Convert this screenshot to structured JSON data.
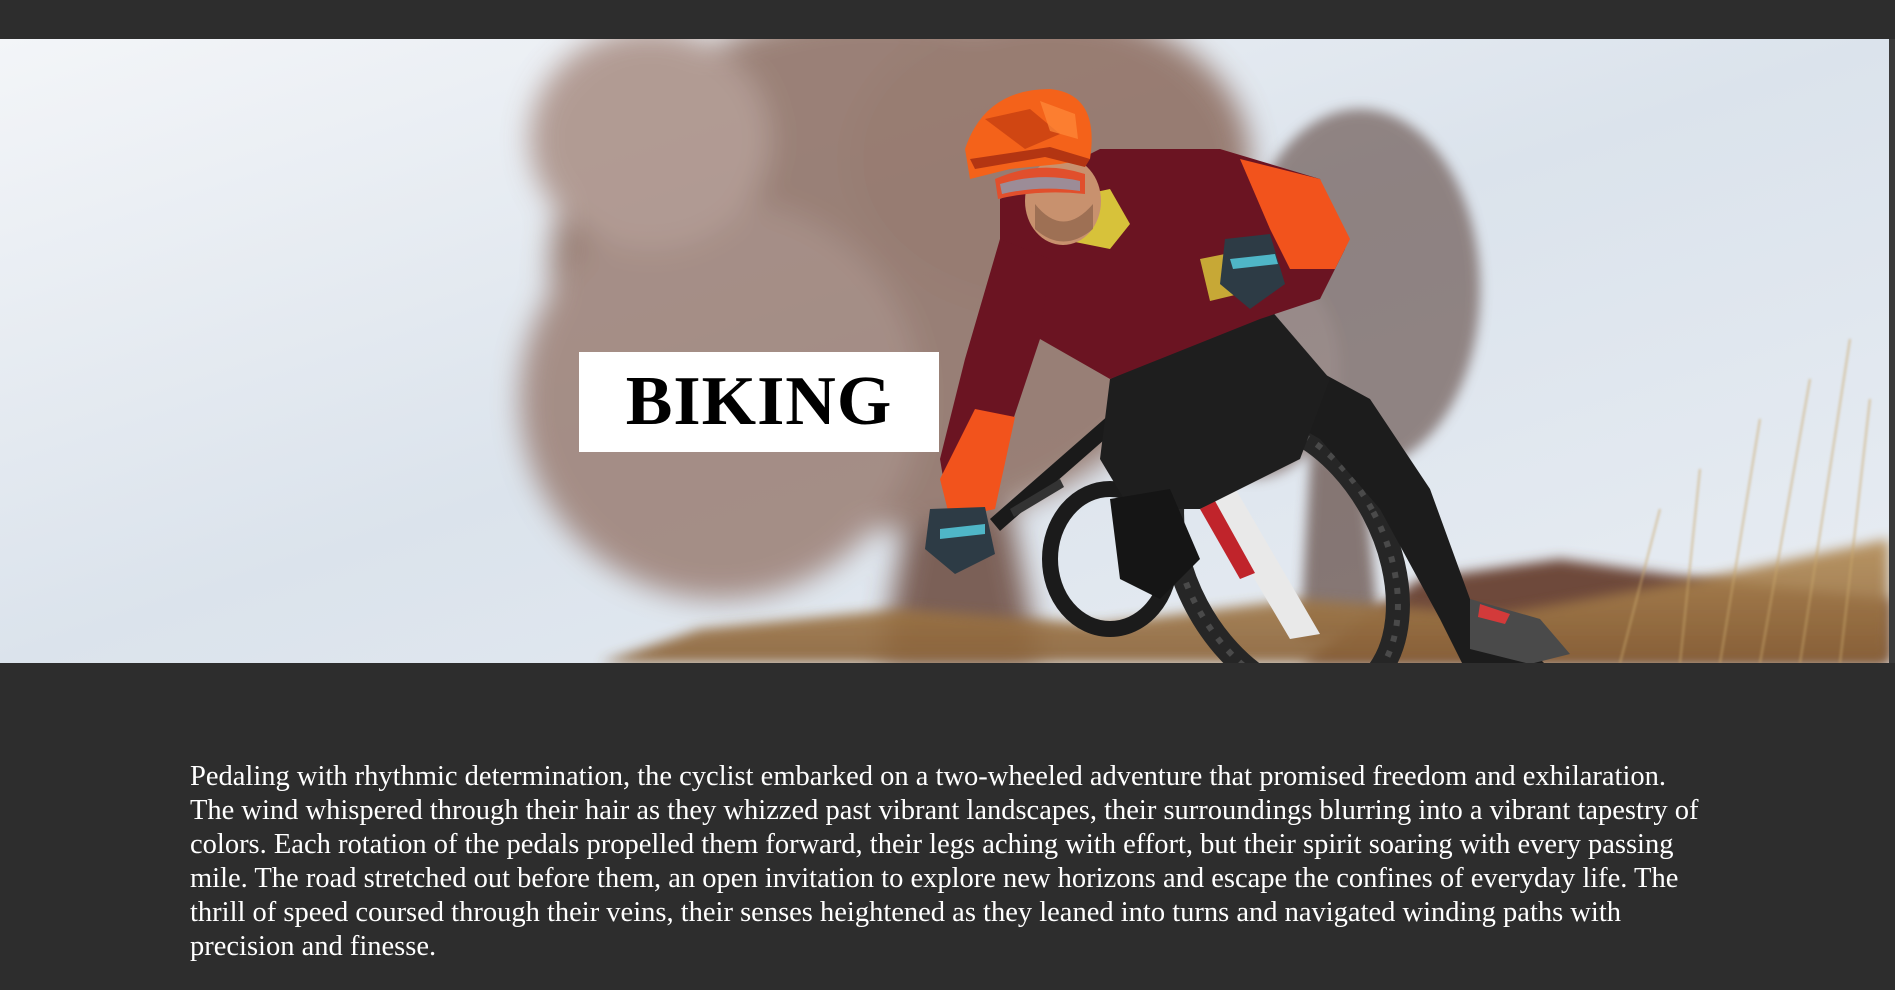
{
  "hero": {
    "title": "BIKING",
    "image_subject": "mountain-biker-photo"
  },
  "article": {
    "body": "Pedaling with rhythmic determination, the cyclist embarked on a two-wheeled adventure that promised freedom and exhilaration. The wind whispered through their hair as they whizzed past vibrant landscapes, their surroundings blurring into a vibrant tapestry of colors. Each rotation of the pedals propelled them forward, their legs aching with effort, but their spirit soaring with every passing mile. The road stretched out before them, an open invitation to explore new horizons and escape the confines of everyday life. The thrill of speed coursed through their veins, their senses heightened as they leaned into turns and navigated winding paths with precision and finesse."
  },
  "colors": {
    "page_background": "#2d2d2d",
    "title_box": "#ffffff",
    "title_text": "#000000",
    "body_text": "#ffffff",
    "jersey": "#6b1422",
    "sleeves": "#f2531c",
    "helmet": "#f4621a"
  }
}
